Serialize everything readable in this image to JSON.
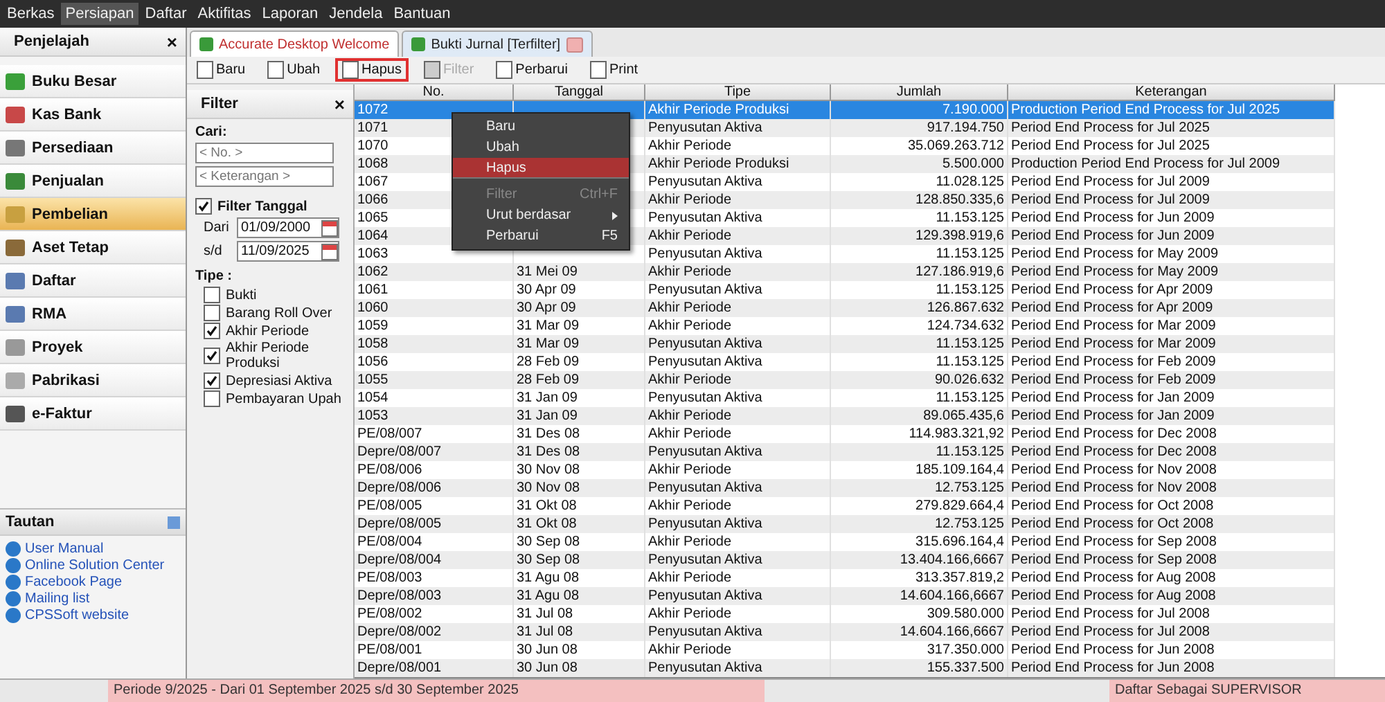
{
  "menu_bar": [
    {
      "label": "Berkas",
      "selected": false
    },
    {
      "label": "Persiapan",
      "selected": true
    },
    {
      "label": "Daftar",
      "selected": false
    },
    {
      "label": "Aktifitas",
      "selected": false
    },
    {
      "label": "Laporan",
      "selected": false
    },
    {
      "label": "Jendela",
      "selected": false
    },
    {
      "label": "Bantuan",
      "selected": false
    }
  ],
  "explorer": {
    "title": "Penjelajah",
    "close": "×",
    "items": [
      {
        "label": "Buku Besar",
        "selected": false
      },
      {
        "label": "Kas Bank",
        "selected": false
      },
      {
        "label": "Persediaan",
        "selected": false
      },
      {
        "label": "Penjualan",
        "selected": false
      },
      {
        "label": "Pembelian",
        "selected": true
      },
      {
        "label": "Aset Tetap",
        "selected": false
      },
      {
        "label": "Daftar",
        "selected": false
      },
      {
        "label": "RMA",
        "selected": false
      },
      {
        "label": "Proyek",
        "selected": false
      },
      {
        "label": "Pabrikasi",
        "selected": false
      },
      {
        "label": "e-Faktur",
        "selected": false
      }
    ]
  },
  "links": {
    "title": "Tautan",
    "items": [
      "User Manual",
      "Online Solution Center",
      "Facebook Page",
      "Mailing list",
      "CPSSoft website"
    ]
  },
  "tabs": [
    {
      "label": "Accurate Desktop Welcome",
      "selected": false
    },
    {
      "label": "Bukti Jurnal [Terfilter]",
      "selected": true
    }
  ],
  "toolbar": [
    {
      "label": "Baru",
      "disabled": false,
      "highlighted": false
    },
    {
      "label": "Ubah",
      "disabled": false,
      "highlighted": false
    },
    {
      "label": "Hapus",
      "disabled": false,
      "highlighted": true
    },
    {
      "label": "Filter",
      "disabled": true,
      "highlighted": false
    },
    {
      "label": "Perbarui",
      "disabled": false,
      "highlighted": false
    },
    {
      "label": "Print",
      "disabled": false,
      "highlighted": false
    }
  ],
  "filter": {
    "title": "Filter",
    "close": "×",
    "search_label": "Cari:",
    "search_fields": [
      {
        "placeholder": "< No. >"
      },
      {
        "placeholder": "< Keterangan >"
      }
    ],
    "date_filter": {
      "label": "Filter Tanggal",
      "checked": true,
      "from_label": "Dari",
      "from": "01/09/2000",
      "to_label": "s/d",
      "to": "11/09/2025"
    },
    "type_label": "Tipe :",
    "types": [
      {
        "label": "Bukti",
        "checked": false
      },
      {
        "label": "Barang Roll Over",
        "checked": false
      },
      {
        "label": "Akhir Periode",
        "checked": true
      },
      {
        "label": "Akhir Periode Produksi",
        "checked": true
      },
      {
        "label": "Depresiasi Aktiva",
        "checked": true
      },
      {
        "label": "Pembayaran Upah",
        "checked": false
      }
    ]
  },
  "table": {
    "columns": [
      "No.",
      "Tanggal",
      "Tipe",
      "Jumlah",
      "Keterangan"
    ],
    "rows": [
      {
        "selected": true,
        "cells": [
          "1072",
          "",
          "Akhir Periode Produksi",
          "7.190.000",
          "Production Period End Process for Jul 2025"
        ]
      },
      {
        "selected": false,
        "cells": [
          "1071",
          "",
          "Penyusutan Aktiva",
          "917.194.750",
          "Period End Process for Jul 2025"
        ]
      },
      {
        "selected": false,
        "cells": [
          "1070",
          "",
          "Akhir Periode",
          "35.069.263.712",
          "Period End Process for Jul 2025"
        ]
      },
      {
        "selected": false,
        "cells": [
          "1068",
          "",
          "Akhir Periode Produksi",
          "5.500.000",
          "Production Period End Process for Jul 2009"
        ]
      },
      {
        "selected": false,
        "cells": [
          "1067",
          "",
          "Penyusutan Aktiva",
          "11.028.125",
          "Period End Process for Jul 2009"
        ]
      },
      {
        "selected": false,
        "cells": [
          "1066",
          "",
          "Akhir Periode",
          "128.850.335,6",
          "Period End Process for Jul 2009"
        ]
      },
      {
        "selected": false,
        "cells": [
          "1065",
          "",
          "Penyusutan Aktiva",
          "11.153.125",
          "Period End Process for Jun 2009"
        ]
      },
      {
        "selected": false,
        "cells": [
          "1064",
          "",
          "Akhir Periode",
          "129.398.919,6",
          "Period End Process for Jun 2009"
        ]
      },
      {
        "selected": false,
        "cells": [
          "1063",
          "",
          "Penyusutan Aktiva",
          "11.153.125",
          "Period End Process for May 2009"
        ]
      },
      {
        "selected": false,
        "cells": [
          "1062",
          "31 Mei 09",
          "Akhir Periode",
          "127.186.919,6",
          "Period End Process for May 2009"
        ]
      },
      {
        "selected": false,
        "cells": [
          "1061",
          "30 Apr 09",
          "Penyusutan Aktiva",
          "11.153.125",
          "Period End Process for Apr 2009"
        ]
      },
      {
        "selected": false,
        "cells": [
          "1060",
          "30 Apr 09",
          "Akhir Periode",
          "126.867.632",
          "Period End Process for Apr 2009"
        ]
      },
      {
        "selected": false,
        "cells": [
          "1059",
          "31 Mar 09",
          "Akhir Periode",
          "124.734.632",
          "Period End Process for Mar 2009"
        ]
      },
      {
        "selected": false,
        "cells": [
          "1058",
          "31 Mar 09",
          "Penyusutan Aktiva",
          "11.153.125",
          "Period End Process for Mar 2009"
        ]
      },
      {
        "selected": false,
        "cells": [
          "1056",
          "28 Feb 09",
          "Penyusutan Aktiva",
          "11.153.125",
          "Period End Process for Feb 2009"
        ]
      },
      {
        "selected": false,
        "cells": [
          "1055",
          "28 Feb 09",
          "Akhir Periode",
          "90.026.632",
          "Period End Process for Feb 2009"
        ]
      },
      {
        "selected": false,
        "cells": [
          "1054",
          "31 Jan 09",
          "Penyusutan Aktiva",
          "11.153.125",
          "Period End Process for Jan 2009"
        ]
      },
      {
        "selected": false,
        "cells": [
          "1053",
          "31 Jan 09",
          "Akhir Periode",
          "89.065.435,6",
          "Period End Process for Jan 2009"
        ]
      },
      {
        "selected": false,
        "cells": [
          "PE/08/007",
          "31 Des 08",
          "Akhir Periode",
          "114.983.321,92",
          "Period End Process for Dec 2008"
        ]
      },
      {
        "selected": false,
        "cells": [
          "Depre/08/007",
          "31 Des 08",
          "Penyusutan Aktiva",
          "11.153.125",
          "Period End Process for Dec 2008"
        ]
      },
      {
        "selected": false,
        "cells": [
          "PE/08/006",
          "30 Nov 08",
          "Akhir Periode",
          "185.109.164,4",
          "Period End Process for Nov 2008"
        ]
      },
      {
        "selected": false,
        "cells": [
          "Depre/08/006",
          "30 Nov 08",
          "Penyusutan Aktiva",
          "12.753.125",
          "Period End Process for Nov 2008"
        ]
      },
      {
        "selected": false,
        "cells": [
          "PE/08/005",
          "31 Okt 08",
          "Akhir Periode",
          "279.829.664,4",
          "Period End Process for Oct 2008"
        ]
      },
      {
        "selected": false,
        "cells": [
          "Depre/08/005",
          "31 Okt 08",
          "Penyusutan Aktiva",
          "12.753.125",
          "Period End Process for Oct 2008"
        ]
      },
      {
        "selected": false,
        "cells": [
          "PE/08/004",
          "30 Sep 08",
          "Akhir Periode",
          "315.696.164,4",
          "Period End Process for Sep 2008"
        ]
      },
      {
        "selected": false,
        "cells": [
          "Depre/08/004",
          "30 Sep 08",
          "Penyusutan Aktiva",
          "13.404.166,6667",
          "Period End Process for Sep 2008"
        ]
      },
      {
        "selected": false,
        "cells": [
          "PE/08/003",
          "31 Agu 08",
          "Akhir Periode",
          "313.357.819,2",
          "Period End Process for Aug 2008"
        ]
      },
      {
        "selected": false,
        "cells": [
          "Depre/08/003",
          "31 Agu 08",
          "Penyusutan Aktiva",
          "14.604.166,6667",
          "Period End Process for Aug 2008"
        ]
      },
      {
        "selected": false,
        "cells": [
          "PE/08/002",
          "31 Jul 08",
          "Akhir Periode",
          "309.580.000",
          "Period End Process for Jul 2008"
        ]
      },
      {
        "selected": false,
        "cells": [
          "Depre/08/002",
          "31 Jul 08",
          "Penyusutan Aktiva",
          "14.604.166,6667",
          "Period End Process for Jul 2008"
        ]
      },
      {
        "selected": false,
        "cells": [
          "PE/08/001",
          "30 Jun 08",
          "Akhir Periode",
          "317.350.000",
          "Period End Process for Jun 2008"
        ]
      },
      {
        "selected": false,
        "cells": [
          "Depre/08/001",
          "30 Jun 08",
          "Penyusutan Aktiva",
          "155.337.500",
          "Period End Process for Jun 2008"
        ]
      }
    ]
  },
  "context_menu": [
    {
      "label": "Baru",
      "disabled": false,
      "selected": false,
      "submenu": false,
      "separator_after": false
    },
    {
      "label": "Ubah",
      "disabled": false,
      "selected": false,
      "submenu": false,
      "separator_after": false
    },
    {
      "label": "Hapus",
      "disabled": false,
      "selected": true,
      "submenu": false,
      "separator_after": true
    },
    {
      "label": "Filter",
      "shortcut": "Ctrl+F",
      "disabled": true,
      "selected": false,
      "submenu": false,
      "separator_after": false
    },
    {
      "label": "Urut berdasar",
      "disabled": false,
      "selected": false,
      "submenu": true,
      "separator_after": false
    },
    {
      "label": "Perbarui",
      "shortcut": "F5",
      "disabled": false,
      "selected": false,
      "submenu": false,
      "separator_after": false
    }
  ],
  "status_bar": {
    "period": "Periode 9/2025 - Dari 01 September 2025 s/d 30 September 2025",
    "user": "Daftar Sebagai SUPERVISOR"
  }
}
